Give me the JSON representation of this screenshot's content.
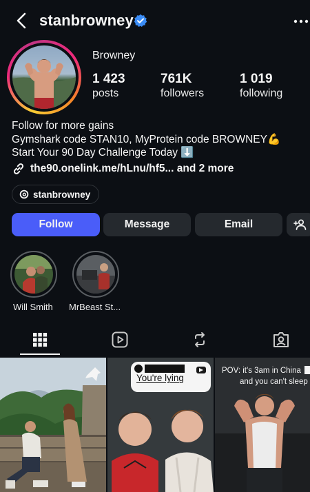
{
  "header": {
    "username": "stanbrowney"
  },
  "profile": {
    "display_name": "Browney",
    "stats": [
      {
        "value": "1 423",
        "label": "posts"
      },
      {
        "value": "761K",
        "label": "followers"
      },
      {
        "value": "1 019",
        "label": "following"
      }
    ],
    "bio": [
      "Follow for more gains",
      "Gymshark code STAN10, MyProtein code BROWNEY💪",
      "Start Your 90 Day Challenge Today ⬇️"
    ],
    "link_text": "the90.onelink.me/hLnu/hf5...",
    "link_more": " and 2 more",
    "threads_handle": "stanbrowney"
  },
  "actions": {
    "follow": "Follow",
    "message": "Message",
    "email": "Email"
  },
  "highlights": [
    {
      "label": "Will Smith"
    },
    {
      "label": "MrBeast St..."
    }
  ],
  "tabs": [
    "grid-icon",
    "reels-icon",
    "reposts-icon",
    "tagged-icon"
  ],
  "grid": [
    {
      "caption": ""
    },
    {
      "caption": "You're lying"
    },
    {
      "caption_line1": "POV: it's 3am in China",
      "caption_line2": "and you can't sleep"
    }
  ],
  "colors": {
    "accent": "#4a5df9",
    "verified": "#3b8cf5",
    "background": "#0c0f14"
  }
}
